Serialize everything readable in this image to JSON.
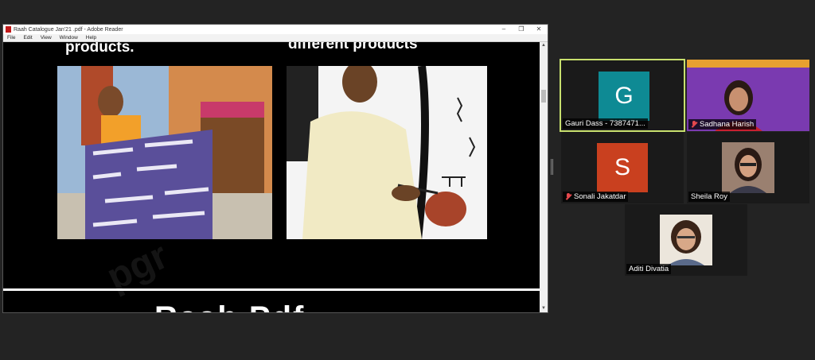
{
  "reader": {
    "title": "Raah Catalogue Jan'21 .pdf - Adobe Reader",
    "menu": [
      "File",
      "Edit",
      "View",
      "Window",
      "Help"
    ],
    "controls": {
      "minimize": "–",
      "restore": "❐",
      "close": "✕"
    }
  },
  "slide": {
    "caption_left": "products.",
    "caption_right": "different products",
    "next_title": "Raah Pdf",
    "watermark": "pgr"
  },
  "participants": [
    {
      "name": "Gauri Dass - 7387471...",
      "avatar": "G",
      "avatar_color": "#0e8a94",
      "active": true,
      "muted": false
    },
    {
      "name": "Sadhana Harish",
      "avatar": "",
      "muted": true
    },
    {
      "name": "Sonali Jakatdar",
      "avatar": "S",
      "avatar_color": "#c9401f",
      "muted": true
    },
    {
      "name": "Sheila Roy",
      "avatar": "",
      "muted": false
    },
    {
      "name": "Aditi Divatia",
      "avatar": "",
      "muted": false
    }
  ],
  "colors": {
    "active_border": "#c8e06e",
    "mute_red": "#e5484d",
    "background": "#232323"
  }
}
